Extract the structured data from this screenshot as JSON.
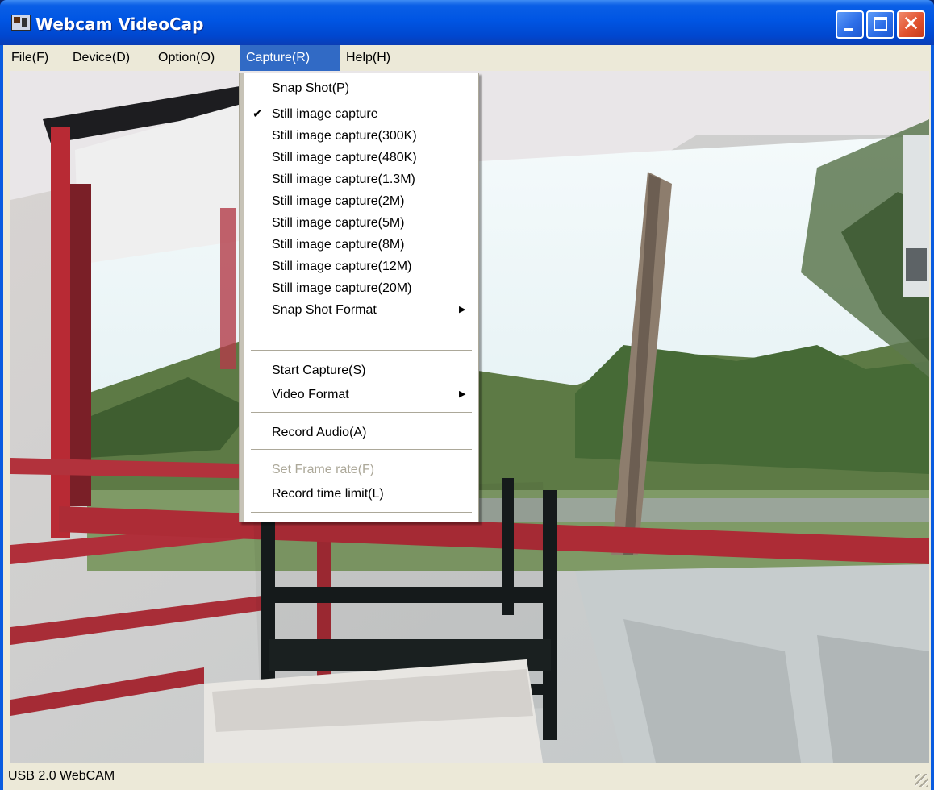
{
  "window": {
    "title": "Webcam VideoCap",
    "close_glyph": "✕"
  },
  "menubar": [
    {
      "label": "File(F)"
    },
    {
      "label": "Device(D)"
    },
    {
      "label": "Option(O)"
    },
    {
      "label": "Capture(R)",
      "active": true
    },
    {
      "label": "Help(H)"
    }
  ],
  "capture_menu": {
    "items": [
      {
        "label": "Snap Shot(P)"
      },
      {
        "label": "Still image capture",
        "checked": true
      },
      {
        "label": "Still image capture(300K)"
      },
      {
        "label": "Still image capture(480K)"
      },
      {
        "label": "Still image capture(1.3M)"
      },
      {
        "label": "Still image capture(2M)"
      },
      {
        "label": "Still image capture(5M)"
      },
      {
        "label": "Still image capture(8M)"
      },
      {
        "label": "Still image capture(12M)"
      },
      {
        "label": "Still image capture(20M)"
      },
      {
        "label": "Snap Shot Format",
        "submenu": true
      },
      {
        "label": "Start Capture(S)"
      },
      {
        "label": "Video Format",
        "submenu": true
      },
      {
        "label": "Record Audio(A)"
      },
      {
        "label": "Set Frame rate(F)",
        "disabled": true
      },
      {
        "label": "Record time limit(L)"
      }
    ],
    "check_glyph": "✔",
    "submenu_glyph": "▶"
  },
  "status": {
    "text": "USB 2.0 WebCAM"
  },
  "colors": {
    "menu_highlight": "#316ac5",
    "titlebar": "#0055e3",
    "disabled_text": "#aca899"
  },
  "icons": {
    "app": "camera-app-icon",
    "minimize": "minimize-icon",
    "maximize": "maximize-icon",
    "close": "close-icon"
  }
}
